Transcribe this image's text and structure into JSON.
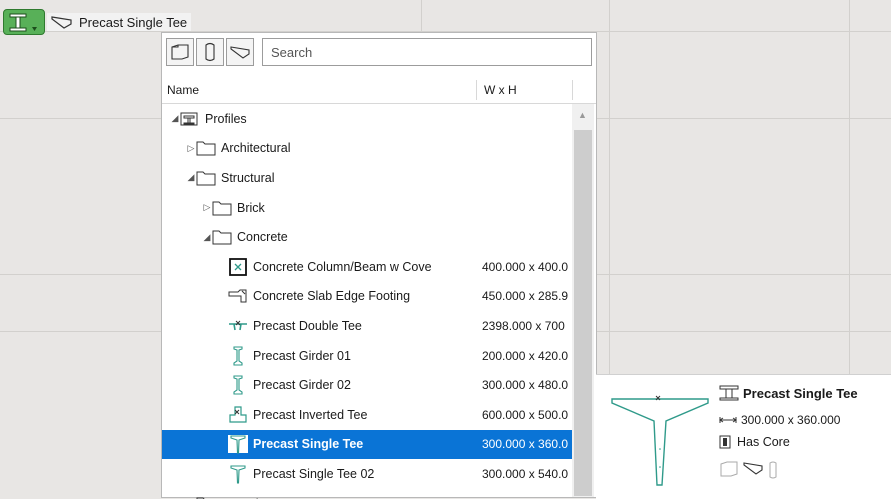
{
  "selector": {
    "icon": "profile-tool-icon",
    "current_profile_label": "Precast Single Tee"
  },
  "panel": {
    "toolbar": {
      "buttons": [
        "wall-view-icon",
        "column-view-icon",
        "beam-view-icon"
      ]
    },
    "search_placeholder": "Search",
    "columns": {
      "name": "Name",
      "wxh": "W x H"
    },
    "tree": [
      {
        "label": "Profiles",
        "value": "",
        "expander": "expanded",
        "icon": "profiles-icon"
      },
      {
        "label": "Architectural",
        "value": "",
        "expander": "collapsed",
        "icon": "folder-icon"
      },
      {
        "label": "Structural",
        "value": "",
        "expander": "expanded",
        "icon": "folder-icon"
      },
      {
        "label": "Brick",
        "value": "",
        "expander": "collapsed",
        "icon": "folder-icon"
      },
      {
        "label": "Concrete",
        "value": "",
        "expander": "expanded",
        "icon": "folder-icon"
      },
      {
        "label": "Concrete Column/Beam w Cove",
        "value": "400.000 x 400.0",
        "expander": "none",
        "icon": "column-beam-icon"
      },
      {
        "label": "Concrete Slab Edge Footing",
        "value": "450.000 x 285.9",
        "expander": "none",
        "icon": "slab-footing-icon"
      },
      {
        "label": "Precast Double Tee",
        "value": "2398.000 x 700",
        "expander": "none",
        "icon": "double-tee-icon"
      },
      {
        "label": "Precast Girder 01",
        "value": "200.000 x 420.0",
        "expander": "none",
        "icon": "girder-icon"
      },
      {
        "label": "Precast Girder 02",
        "value": "300.000 x 480.0",
        "expander": "none",
        "icon": "girder-icon"
      },
      {
        "label": "Precast Inverted Tee",
        "value": "600.000 x 500.0",
        "expander": "none",
        "icon": "inverted-tee-icon"
      },
      {
        "label": "Precast Single Tee",
        "value": "300.000 x 360.0",
        "expander": "none",
        "icon": "single-tee-icon",
        "selected": true
      },
      {
        "label": "Precast Single Tee 02",
        "value": "300.000 x 540.0",
        "expander": "none",
        "icon": "single-tee-icon"
      },
      {
        "label": "Generic",
        "value": "",
        "expander": "collapsed",
        "icon": "folder-icon"
      }
    ]
  },
  "preview": {
    "title": "Precast Single Tee",
    "dimensions": "300.000 x 360.000",
    "core": "Has Core",
    "usage_icons": [
      "wall-usage-icon",
      "beam-usage-icon",
      "column-usage-icon"
    ]
  },
  "colors": {
    "selection": "#0a74d6",
    "accent_green": "#58b058",
    "profile_teal": "#2f9a8a"
  }
}
